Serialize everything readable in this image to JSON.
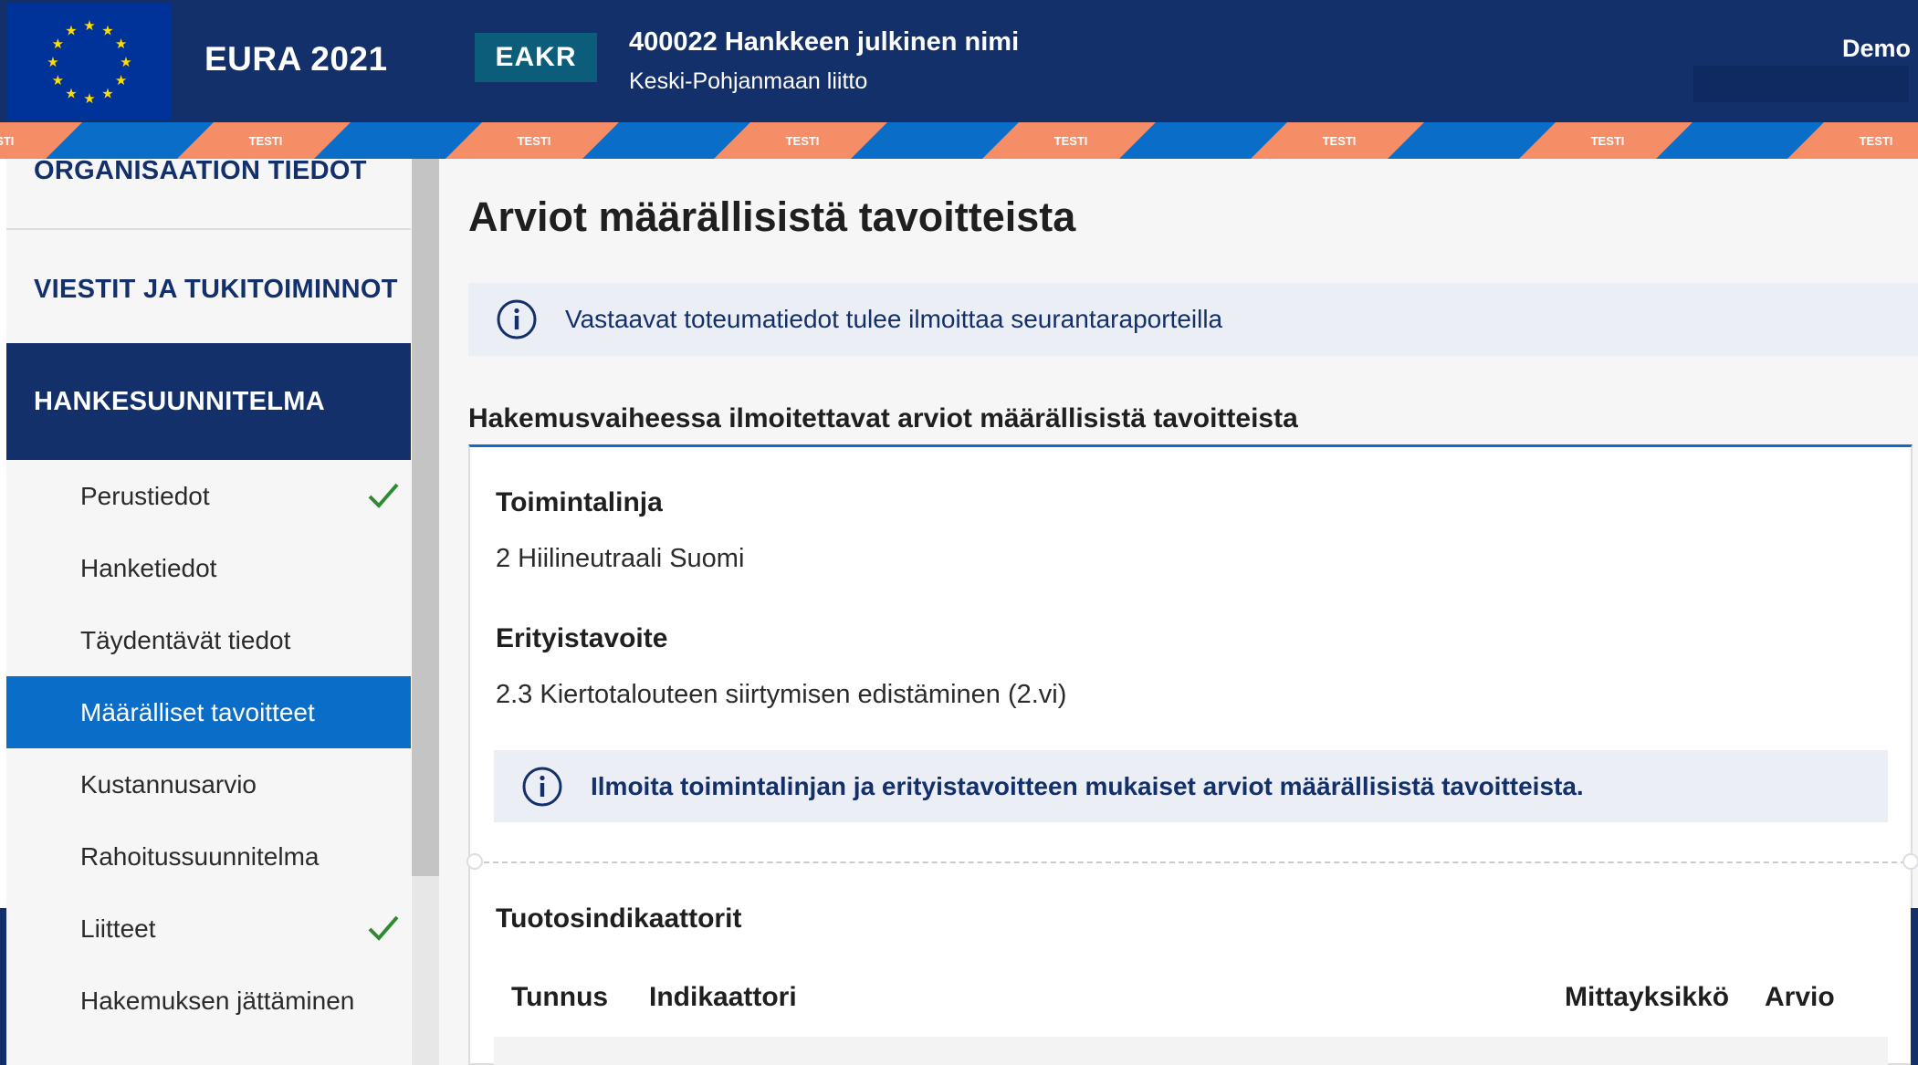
{
  "header": {
    "app_title": "EURA 2021",
    "fund_badge": "EAKR",
    "project_name": "400022 Hankkeen julkinen nimi",
    "organization": "Keski-Pohjanmaan liitto",
    "user_name": "Demo",
    "test_label": "TESTI"
  },
  "sidebar": {
    "sections": [
      {
        "label": "ORGANISAATION TIEDOT"
      },
      {
        "label": "VIESTIT JA TUKITOIMINNOT"
      },
      {
        "label": "HANKESUUNNITELMA"
      }
    ],
    "items": [
      {
        "label": "Perustiedot",
        "completed": true
      },
      {
        "label": "Hanketiedot",
        "completed": false
      },
      {
        "label": "Täydentävät tiedot",
        "completed": false
      },
      {
        "label": "Määrälliset tavoitteet",
        "completed": false,
        "active": true
      },
      {
        "label": "Kustannusarvio",
        "completed": false
      },
      {
        "label": "Rahoitussuunnitelma",
        "completed": false
      },
      {
        "label": "Liitteet",
        "completed": true
      },
      {
        "label": "Hakemuksen jättäminen",
        "completed": false
      }
    ]
  },
  "main": {
    "title": "Arviot määrällisistä tavoitteista",
    "info": "Vastaavat toteumatiedot tulee ilmoittaa seurantaraporteilla",
    "section_heading": "Hakemusvaiheessa ilmoitettavat arviot määrällisistä tavoitteista",
    "fields": [
      {
        "label": "Toimintalinja",
        "value": "2 Hiilineutraali Suomi"
      },
      {
        "label": "Erityistavoite",
        "value": "2.3 Kiertotalouteen siirtymisen edistäminen (2.vi)"
      }
    ],
    "inner_info": "Ilmoita toimintalinjan ja erityistavoitteen mukaiset arviot määrällisistä tavoitteista.",
    "indicators_heading": "Tuotosindikaattorit",
    "table_headers": [
      "Tunnus",
      "Indikaattori",
      "Mittayksikkö",
      "Arvio"
    ]
  },
  "colors": {
    "header_bg": "#13306b",
    "accent_blue": "#0a6ec9",
    "badge_bg": "#0b5d79",
    "stripe_orange": "#f58e66",
    "check_green": "#2e8b2e"
  }
}
